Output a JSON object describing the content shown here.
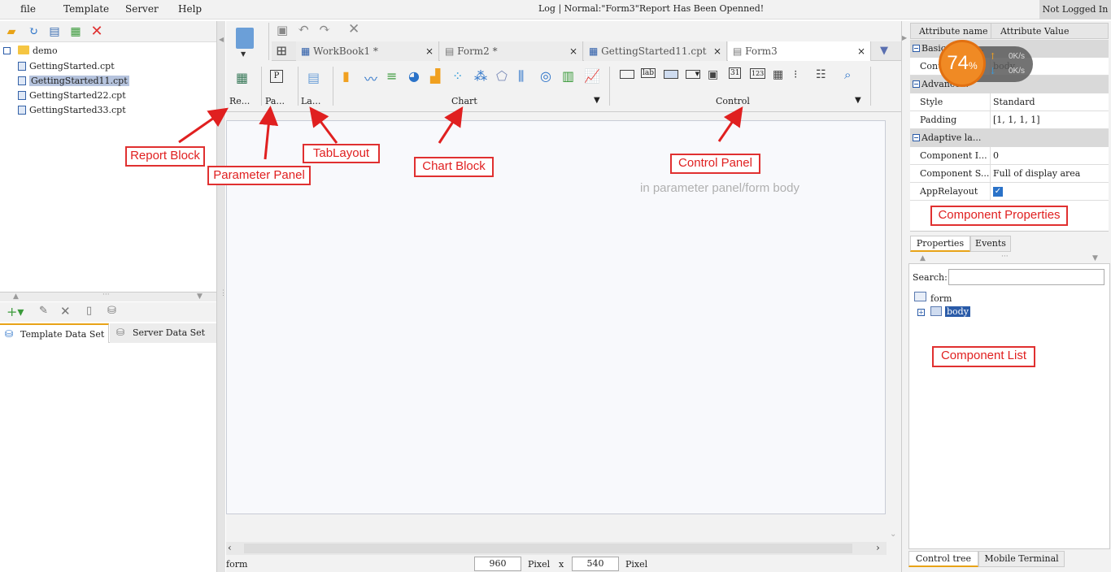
{
  "menubar": {
    "items": [
      "file",
      "Template",
      "Server",
      "Help"
    ],
    "status": "Log | Normal:\"Form3\"Report Has Been Openned!",
    "login": "Not Logged In"
  },
  "left": {
    "tree_root": "demo",
    "files": [
      "GettingStarted.cpt",
      "GettingStarted11.cpt",
      "GettingStarted22.cpt",
      "GettingStarted33.cpt"
    ],
    "selected_index": 1,
    "dataset_tabs": [
      "Template Data Set",
      "Server Data Set"
    ]
  },
  "editor": {
    "tabs": [
      {
        "label": "WorkBook1 *",
        "close": "×"
      },
      {
        "label": "Form2 *",
        "close": "×"
      },
      {
        "label": "GettingStarted11.cpt",
        "close": "×"
      },
      {
        "label": "Form3",
        "close": "×"
      }
    ],
    "blocks": {
      "report": "Re...",
      "param": "Pa...",
      "layout": "La...",
      "chart": "Chart",
      "control": "Control"
    },
    "canvas_hint": "in parameter panel/form body",
    "status_left": "form",
    "width_value": "960",
    "height_value": "540",
    "pixel_label1": "Pixel",
    "x_label": "x",
    "pixel_label2": "Pixel"
  },
  "annotations": {
    "report_block": "Report Block",
    "parameter_panel": "Parameter Panel",
    "tab_layout": "TabLayout",
    "chart_block": "Chart Block",
    "control_panel": "Control Panel",
    "component_properties": "Component Properties",
    "component_list": "Component List"
  },
  "properties": {
    "header_name": "Attribute name",
    "header_value": "Attribute Value",
    "sections": {
      "basic": "Basic Prope...",
      "advanced": "Advance...",
      "adaptive": "Adaptive la..."
    },
    "rows": {
      "control_name_key": "Cont...",
      "control_name_value": "body",
      "style_key": "Style",
      "style_value": "Standard",
      "padding_key": "Padding",
      "padding_value": "[1, 1, 1, 1]",
      "comp_i_key": "Component I...",
      "comp_i_value": "0",
      "comp_s_key": "Component S...",
      "comp_s_value": "Full of display area",
      "relayout_key": "AppRelayout"
    },
    "tabs": [
      "Properties",
      "Events"
    ],
    "search_label": "Search:",
    "tree_form": "form",
    "tree_body": "body",
    "bottom_tabs": [
      "Control tree",
      "Mobile Terminal"
    ]
  },
  "speed_widget": {
    "percent": "74",
    "percent_sign": "%",
    "up": "0K/s",
    "down": "0K/s"
  },
  "colors": {
    "annotation_red": "#e02020",
    "selected_bg": "#b5c3dd",
    "speed_orange": "#f08a24"
  }
}
